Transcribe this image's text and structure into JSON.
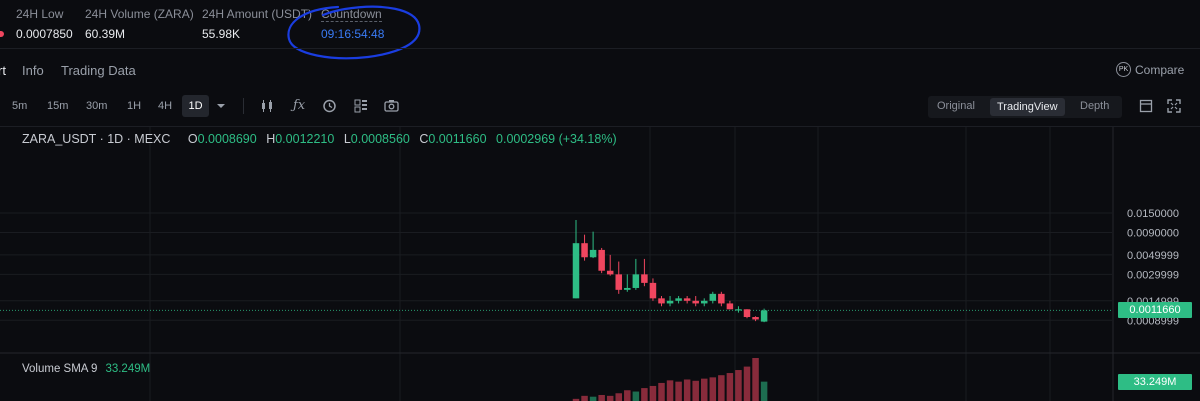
{
  "stats": {
    "low": {
      "label": "24H Low",
      "value": "0.0007850"
    },
    "volume": {
      "label": "24H Volume (ZARA)",
      "value": "60.39M"
    },
    "amount": {
      "label": "24H Amount (USDT)",
      "value": "55.98K"
    },
    "countdown": {
      "label": "Countdown",
      "value": "09:16:54:48"
    }
  },
  "tabs": [
    {
      "label": "rt"
    },
    {
      "label": "Info"
    },
    {
      "label": "Trading Data"
    }
  ],
  "compare": {
    "icon_text": "PK",
    "label": "Compare"
  },
  "timeframes": [
    "5m",
    "15m",
    "30m",
    "1H",
    "4H",
    "1D"
  ],
  "active_timeframe": "1D",
  "tool_icons": [
    "chevron-down-icon",
    "candlestick-type-icon",
    "indicators-fx-icon",
    "alert-clock-icon",
    "layout-grid-icon",
    "camera-icon"
  ],
  "views": {
    "original": "Original",
    "tradingview": "TradingView",
    "depth": "Depth"
  },
  "legend": {
    "symbol": "ZARA_USDT · 1D · MEXC",
    "o_key": "O",
    "o_val": "0.0008690",
    "h_key": "H",
    "h_val": "0.0012210",
    "l_key": "L",
    "l_val": "0.0008560",
    "c_key": "C",
    "c_val": "0.0011660",
    "change": "0.0002969 (+34.18%)"
  },
  "volume_indicator": {
    "label": "Volume SMA 9",
    "value": "33.249M"
  },
  "colors": {
    "up": "#2ebd85",
    "down": "#f0465f",
    "accent": "#3a7bf5",
    "background": "#0b0c10"
  },
  "chart_data": {
    "type": "candlestick",
    "y_scale": "log",
    "y_ticks": [
      "0.0150000",
      "0.0090000",
      "0.0049999",
      "0.0029999",
      "0.0014999",
      "0.0008999"
    ],
    "y_tick_values": [
      0.015,
      0.009,
      0.0049999,
      0.0029999,
      0.0014999,
      0.0008999
    ],
    "last_price_label": "0.0011660",
    "last_price": 0.001166,
    "volume_badge": "33.249M",
    "candles": [
      {
        "o": 0.0016,
        "h": 0.0125,
        "l": 0.0016,
        "c": 0.0068
      },
      {
        "o": 0.0068,
        "h": 0.0085,
        "l": 0.0043,
        "c": 0.0047
      },
      {
        "o": 0.0047,
        "h": 0.0092,
        "l": 0.0046,
        "c": 0.0057
      },
      {
        "o": 0.0057,
        "h": 0.006,
        "l": 0.0031,
        "c": 0.0033
      },
      {
        "o": 0.0033,
        "h": 0.005,
        "l": 0.0029,
        "c": 0.003
      },
      {
        "o": 0.003,
        "h": 0.0042,
        "l": 0.0018,
        "c": 0.002
      },
      {
        "o": 0.002,
        "h": 0.003,
        "l": 0.0019,
        "c": 0.0021
      },
      {
        "o": 0.0021,
        "h": 0.0045,
        "l": 0.002,
        "c": 0.003
      },
      {
        "o": 0.003,
        "h": 0.0045,
        "l": 0.0022,
        "c": 0.0024
      },
      {
        "o": 0.0024,
        "h": 0.0027,
        "l": 0.0015,
        "c": 0.0016
      },
      {
        "o": 0.0016,
        "h": 0.0017,
        "l": 0.0013,
        "c": 0.0014
      },
      {
        "o": 0.0014,
        "h": 0.0017,
        "l": 0.0013,
        "c": 0.0015
      },
      {
        "o": 0.0015,
        "h": 0.0017,
        "l": 0.0014,
        "c": 0.0016
      },
      {
        "o": 0.0016,
        "h": 0.0017,
        "l": 0.0014,
        "c": 0.0015
      },
      {
        "o": 0.0015,
        "h": 0.0017,
        "l": 0.0013,
        "c": 0.0014
      },
      {
        "o": 0.0014,
        "h": 0.0016,
        "l": 0.0013,
        "c": 0.0015
      },
      {
        "o": 0.0015,
        "h": 0.0019,
        "l": 0.0014,
        "c": 0.0018
      },
      {
        "o": 0.0018,
        "h": 0.0019,
        "l": 0.0013,
        "c": 0.0014
      },
      {
        "o": 0.0014,
        "h": 0.0015,
        "l": 0.0012,
        "c": 0.0012
      },
      {
        "o": 0.0012,
        "h": 0.0013,
        "l": 0.0011,
        "c": 0.0012
      },
      {
        "o": 0.0012,
        "h": 0.0012,
        "l": 0.00095,
        "c": 0.00098
      },
      {
        "o": 0.00098,
        "h": 0.001,
        "l": 0.00088,
        "c": 0.00092
      },
      {
        "o": 0.000869,
        "h": 0.001221,
        "l": 0.000856,
        "c": 0.001166
      }
    ],
    "volume_bars": [
      {
        "up": false,
        "v": 0.05
      },
      {
        "up": false,
        "v": 0.12
      },
      {
        "up": true,
        "v": 0.1
      },
      {
        "up": false,
        "v": 0.14
      },
      {
        "up": false,
        "v": 0.12
      },
      {
        "up": false,
        "v": 0.18
      },
      {
        "up": false,
        "v": 0.25
      },
      {
        "up": true,
        "v": 0.22
      },
      {
        "up": false,
        "v": 0.3
      },
      {
        "up": false,
        "v": 0.35
      },
      {
        "up": false,
        "v": 0.42
      },
      {
        "up": false,
        "v": 0.48
      },
      {
        "up": false,
        "v": 0.45
      },
      {
        "up": false,
        "v": 0.5
      },
      {
        "up": false,
        "v": 0.47
      },
      {
        "up": false,
        "v": 0.52
      },
      {
        "up": false,
        "v": 0.55
      },
      {
        "up": false,
        "v": 0.6
      },
      {
        "up": false,
        "v": 0.65
      },
      {
        "up": false,
        "v": 0.72
      },
      {
        "up": false,
        "v": 0.8
      },
      {
        "up": false,
        "v": 1.0
      },
      {
        "up": true,
        "v": 0.45
      }
    ]
  }
}
